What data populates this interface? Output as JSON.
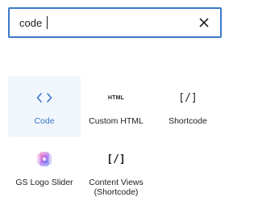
{
  "search": {
    "value": "code",
    "placeholder": "Search"
  },
  "blocks": [
    {
      "label": "Code",
      "icon": "code-icon",
      "selected": true
    },
    {
      "label": "Custom HTML",
      "icon": "html-icon",
      "icon_text": "HTML"
    },
    {
      "label": "Shortcode",
      "icon": "shortcode-icon",
      "icon_text": "[/]"
    },
    {
      "label": "GS Logo Slider",
      "icon": "gs-logo-slider-icon"
    },
    {
      "label": "Content Views (Shortcode)",
      "icon": "content-views-shortcode-icon",
      "icon_text": "[/]"
    }
  ],
  "colors": {
    "accent": "#3a78c8",
    "selected_bg": "#f0f6fc",
    "text": "#1e1e1e"
  }
}
